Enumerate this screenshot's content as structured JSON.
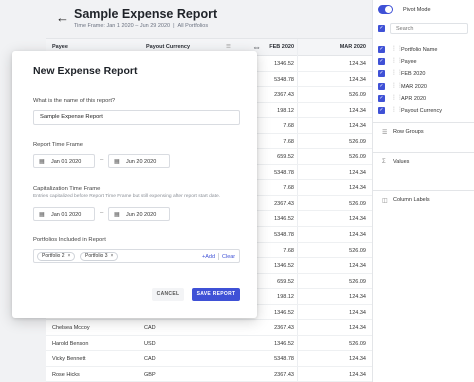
{
  "report": {
    "title": "Sample Expense Report",
    "time_frame": "Time Frame: Jan 1 2020 – Jun 29 2020",
    "sep": "|",
    "portfolios": "All Portfolios"
  },
  "grid": {
    "headers": {
      "payee": "Payee",
      "currency": "Payout Currency",
      "feb": "FEB 2020",
      "mar": "MAR 2020"
    },
    "rows": [
      {
        "payee": "",
        "currency": "",
        "feb": "1346.52",
        "mar": "124.34"
      },
      {
        "payee": "",
        "currency": "",
        "feb": "5348.78",
        "mar": "124.34"
      },
      {
        "payee": "",
        "currency": "",
        "feb": "2367.43",
        "mar": "526.09"
      },
      {
        "payee": "",
        "currency": "",
        "feb": "198.12",
        "mar": "124.34"
      },
      {
        "payee": "",
        "currency": "",
        "feb": "7.68",
        "mar": "124.34"
      },
      {
        "payee": "",
        "currency": "",
        "feb": "7.68",
        "mar": "526.09"
      },
      {
        "payee": "",
        "currency": "",
        "feb": "659.52",
        "mar": "526.09"
      },
      {
        "payee": "",
        "currency": "",
        "feb": "5348.78",
        "mar": "124.34"
      },
      {
        "payee": "",
        "currency": "",
        "feb": "7.68",
        "mar": "124.34"
      },
      {
        "payee": "",
        "currency": "",
        "feb": "2367.43",
        "mar": "526.09"
      },
      {
        "payee": "",
        "currency": "",
        "feb": "1346.52",
        "mar": "124.34"
      },
      {
        "payee": "",
        "currency": "",
        "feb": "5348.78",
        "mar": "124.34"
      },
      {
        "payee": "",
        "currency": "",
        "feb": "7.68",
        "mar": "526.09"
      },
      {
        "payee": "",
        "currency": "",
        "feb": "1346.52",
        "mar": "124.34"
      },
      {
        "payee": "",
        "currency": "",
        "feb": "659.52",
        "mar": "526.09"
      },
      {
        "payee": "",
        "currency": "",
        "feb": "198.12",
        "mar": "124.34"
      },
      {
        "payee": "",
        "currency": "",
        "feb": "1346.52",
        "mar": "124.34"
      },
      {
        "payee": "Chelsea Mccoy",
        "currency": "CAD",
        "feb": "2367.43",
        "mar": "124.34"
      },
      {
        "payee": "Harold Benson",
        "currency": "USD",
        "feb": "1346.52",
        "mar": "526.09"
      },
      {
        "payee": "Vicky Bennett",
        "currency": "CAD",
        "feb": "5348.78",
        "mar": "124.34"
      },
      {
        "payee": "Rose Hicks",
        "currency": "GBP",
        "feb": "2367.43",
        "mar": "124.34"
      }
    ]
  },
  "panel": {
    "pivot_mode": "Pivot Mode",
    "search_placeholder": "Search",
    "columns": [
      "Portfolio Name",
      "Payee",
      "FEB 2020",
      "MAR 2020",
      "APR 2020",
      "Payout Currency"
    ],
    "row_groups": "Row Groups",
    "values": "Values",
    "column_labels": "Column Labels"
  },
  "modal": {
    "title": "New Expense Report",
    "name_label": "What is the name of this report?",
    "name_value": "Sample Expense Report",
    "time_frame_label": "Report Time Frame",
    "tf_start": "Jan 01 2020",
    "tf_end": "Jun 20 2020",
    "cap_label": "Capitalization Time Frame",
    "cap_hint": "Entries capitalized before Report Time Frame but still expensing after report start date.",
    "cap_start": "Jan 01 2020",
    "cap_end": "Jun 20 2020",
    "portfolios_label": "Portfolios Included in Report",
    "chips": [
      "Portfolio 2",
      "Portfolio 3"
    ],
    "add": "+Add",
    "clear": "Clear",
    "cancel": "CANCEL",
    "save": "SAVE REPORT"
  },
  "colors": {
    "accent": "#3f51d6"
  },
  "icons": [
    "back-arrow-icon",
    "calendar-icon",
    "close-icon",
    "grip-icon",
    "sigma-icon",
    "column-labels-icon"
  ]
}
